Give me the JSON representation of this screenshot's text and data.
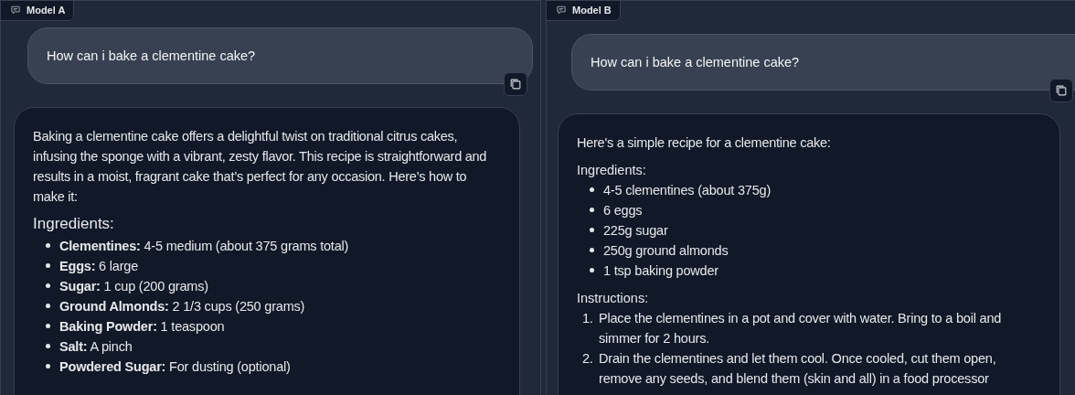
{
  "panels": [
    {
      "label": "Model A",
      "question": "How can i bake a clementine cake?",
      "answer": [
        {
          "kind": "paragraph",
          "text": "Baking a clementine cake offers a delightful twist on traditional citrus cakes, infusing the sponge with a vibrant, zesty flavor. This recipe is straightforward and results in a moist, fragrant cake that’s perfect for any occasion. Here’s how to make it:"
        },
        {
          "kind": "heading",
          "text": "Ingredients:"
        },
        {
          "kind": "bullets",
          "items": [
            "**Clementines:** 4-5 medium (about 375 grams total)",
            "**Eggs:** 6 large",
            "**Sugar:** 1 cup (200 grams)",
            "**Ground Almonds:** 2 1/3 cups (250 grams)",
            "**Baking Powder:** 1 teaspoon",
            "**Salt:** A pinch",
            "**Powdered Sugar:** For dusting (optional)"
          ]
        }
      ]
    },
    {
      "label": "Model B",
      "question": "How can i bake a clementine cake?",
      "answer": [
        {
          "kind": "paragraph",
          "text": "Here's a simple recipe for a clementine cake:"
        },
        {
          "kind": "label",
          "text": "Ingredients:"
        },
        {
          "kind": "bullets",
          "items": [
            "4-5 clementines (about 375g)",
            "6 eggs",
            "225g sugar",
            "250g ground almonds",
            "1 tsp baking powder"
          ]
        },
        {
          "kind": "label",
          "text": "Instructions:"
        },
        {
          "kind": "steps",
          "items": [
            {
              "number": "1.",
              "text": "Place the clementines in a pot and cover with water. Bring to a boil and simmer for 2 hours."
            },
            {
              "number": "2.",
              "text": "Drain the clementines and let them cool. Once cooled, cut them open, remove any seeds, and blend them (skin and all) in a food processor"
            }
          ]
        }
      ]
    }
  ]
}
